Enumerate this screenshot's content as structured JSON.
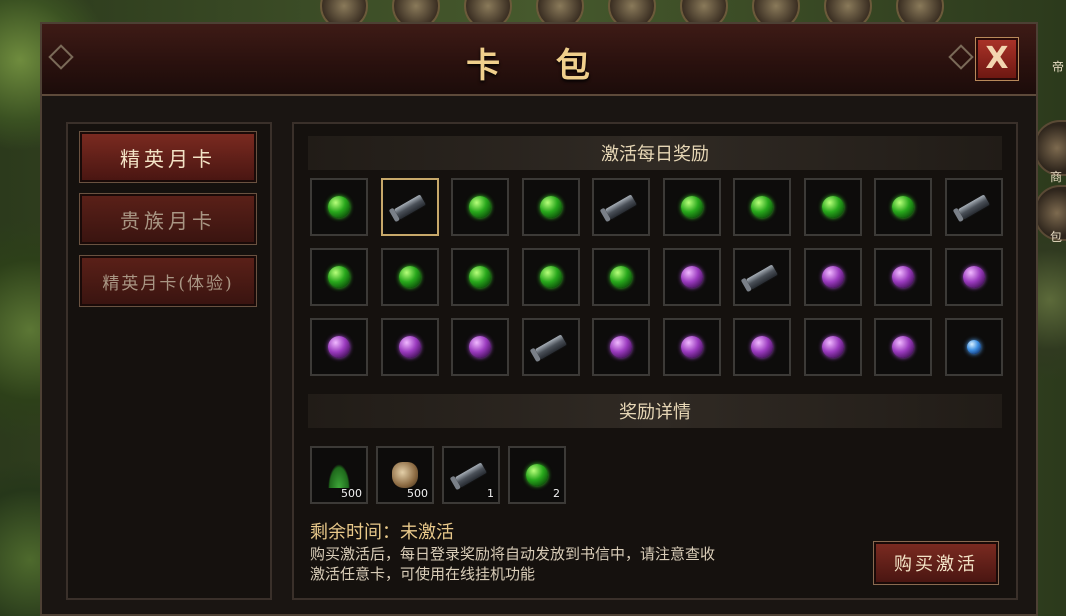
{
  "window": {
    "title": "卡 包",
    "close_glyph": "X"
  },
  "side": {
    "label_1": "帝",
    "label_2": "商",
    "label_3": "包"
  },
  "nav": {
    "items": [
      {
        "label": "精英月卡",
        "active": true
      },
      {
        "label": "贵族月卡",
        "active": false
      },
      {
        "label": "精英月卡(体验)",
        "active": false
      }
    ]
  },
  "daily": {
    "header": "激活每日奖励",
    "items": [
      "green-orb",
      "scroll",
      "green-orb",
      "green-orb",
      "scroll",
      "green-orb",
      "green-orb",
      "green-orb",
      "green-orb",
      "scroll",
      "green-orb",
      "green-orb",
      "green-orb",
      "green-orb",
      "green-orb",
      "purple-orb",
      "scroll",
      "purple-orb",
      "purple-orb",
      "purple-orb",
      "purple-orb",
      "purple-orb",
      "purple-orb",
      "scroll",
      "purple-orb",
      "purple-orb",
      "purple-orb",
      "purple-orb",
      "purple-orb",
      "blue-orb"
    ],
    "selected_index": 1
  },
  "details": {
    "header": "奖励详情",
    "items": [
      {
        "icon": "grass",
        "qty": "500"
      },
      {
        "icon": "sack",
        "qty": "500"
      },
      {
        "icon": "scroll",
        "qty": "1"
      },
      {
        "icon": "green-orb",
        "qty": "2"
      }
    ]
  },
  "status": "剩余时间：未激活",
  "description": [
    "购买激活后，每日登录奖励将自动发放到书信中，请注意查收",
    "激活任意卡，可使用在线挂机功能"
  ],
  "buy_button": "购买激活"
}
